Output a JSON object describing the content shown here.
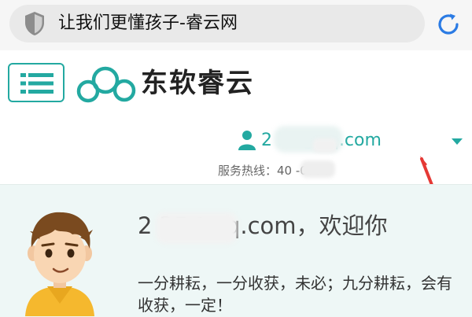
{
  "browser": {
    "address_text": "让我们更懂孩子-睿云网"
  },
  "header": {
    "logo_text": "东软睿云"
  },
  "user": {
    "email": "2        35@qq.com",
    "hotline": "服务热线：40        -0790"
  },
  "welcome": {
    "greeting": "2         35@qq.com，欢迎你",
    "motto": "一分耕耘，一分收获，未必；九分耕耘，会有收获，一定！"
  },
  "colors": {
    "accent": "#23a9a1",
    "annotation_arrow": "#e53935",
    "panel_bg": "#eef7f6"
  }
}
